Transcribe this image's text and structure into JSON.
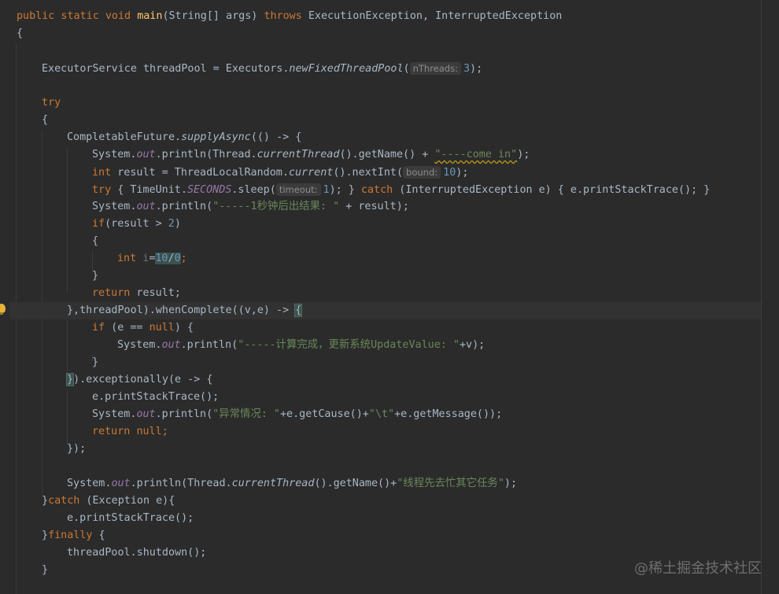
{
  "code": {
    "l1": {
      "mods": "public static void ",
      "name": "main",
      "params": "(String[] args) ",
      "throws": "throws",
      "exc": " ExecutionException, InterruptedException"
    },
    "l2": "{",
    "l3": {
      "pre": "ExecutorService threadPool = Executors.",
      "call": "newFixedThreadPool",
      "open": "(",
      "hint": "nThreads:",
      "arg": "3",
      "close": ");"
    },
    "l4": {
      "kw": "try"
    },
    "l5": "{",
    "l6": {
      "cls": "CompletableFuture.",
      "call": "supplyAsync",
      "rest": "(() -> {"
    },
    "l7": {
      "sys": "System.",
      "out": "out",
      "println": ".println(Thread.",
      "cur": "currentThread",
      "mid": "().getName() + ",
      "str": "\"----come in\"",
      "end": ");"
    },
    "l8": {
      "kw": "int",
      "mid": " result = ThreadLocalRandom.",
      "cur": "current",
      "call": "().nextInt(",
      "hint": "bound:",
      "num": "10",
      "end": ");"
    },
    "l9": {
      "kw": "try",
      "a": " { TimeUnit.",
      "sec": "SECONDS",
      "b": ".sleep(",
      "hint": "timeout:",
      "num": "1",
      "c": "); } ",
      "catch": "catch",
      "d": " (InterruptedException e) { e.printStackTrace(); }"
    },
    "l10": {
      "sys": "System.",
      "out": "out",
      "a": ".println(",
      "str": "\"-----1秒钟后出结果: \"",
      "b": " + result);"
    },
    "l11": {
      "kw": "if",
      "a": "(result > ",
      "num": "2",
      "b": ")"
    },
    "l12": "{",
    "l13": {
      "kw": "int",
      "var": " i",
      "eq": "=",
      "n1": "10",
      "sl": "/",
      "n2": "0",
      "semi": ";"
    },
    "l14": "}",
    "l15": {
      "kw": "return",
      "rest": " result;"
    },
    "l16": {
      "a": "},threadPool).whenComplete((v,e) -> ",
      "brace": "{"
    },
    "l17": {
      "kw": "if",
      "a": " (e == ",
      "nul": "null",
      "b": ") {"
    },
    "l18": {
      "sys": "System.",
      "out": "out",
      "a": ".println(",
      "str": "\"-----计算完成，更新系统UpdateValue: \"",
      "b": "+v);"
    },
    "l19": "}",
    "l20": {
      "brace": "}",
      "a": ").exceptionally(e -> {"
    },
    "l21": "e.printStackTrace();",
    "l22": {
      "sys": "System.",
      "out": "out",
      "a": ".println(",
      "str": "\"异常情况: \"",
      "b": "+e.getCause()+",
      "tab": "\"\\t\"",
      "c": "+e.getMessage());"
    },
    "l23": {
      "kw": "return",
      "a": " ",
      "nul": "null",
      "semi": ";"
    },
    "l24": "});",
    "l25": {
      "sys": "System.",
      "out": "out",
      "a": ".println(Thread.",
      "cur": "currentThread",
      "b": "().getName()+",
      "str": "\"线程先去忙其它任务\"",
      "c": ");"
    },
    "l26": {
      "a": "}",
      "kw": "catch",
      "b": " (Exception e){"
    },
    "l27": "e.printStackTrace();",
    "l28": {
      "a": "}",
      "kw": "finally",
      "b": " {"
    },
    "l29": "threadPool.shutdown();",
    "l30": "}"
  },
  "watermark": "@稀土掘金技术社区"
}
